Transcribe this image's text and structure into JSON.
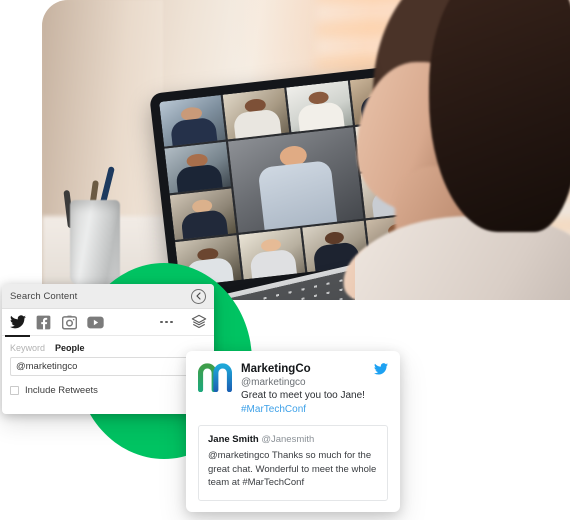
{
  "palette": {
    "brand_green": "#00c362",
    "twitter_blue": "#3ea1e8",
    "link_blue": "#3ea1e8",
    "panel_header_bg": "#ededed"
  },
  "hero": {
    "alt": "woman on video conference call with laptop showing grid of participants",
    "participant_count": 13
  },
  "search_panel": {
    "title": "Search Content",
    "back_icon": "chevron-left-icon",
    "networks": [
      {
        "name": "twitter-icon",
        "label": "Twitter",
        "active": true
      },
      {
        "name": "facebook-icon",
        "label": "Facebook",
        "active": false
      },
      {
        "name": "instagram-icon",
        "label": "Instagram",
        "active": false
      },
      {
        "name": "youtube-icon",
        "label": "YouTube",
        "active": false
      }
    ],
    "more_icon": "more-horizontal-icon",
    "layers_icon": "layers-icon",
    "tabs": [
      {
        "label": "Keyword",
        "active": false
      },
      {
        "label": "People",
        "active": true
      }
    ],
    "keyword_value": "@marketingco",
    "keyword_placeholder": "@marketingco",
    "search_icon": "search-icon",
    "retweets_label": "Include Retweets",
    "retweets_checked": false
  },
  "tweet": {
    "avatar_icon": "marketingco-logo",
    "display_name": "MarketingCo",
    "handle": "@marketingco",
    "text": "Great to meet you too Jane!",
    "hashtag": "#MarTechConf",
    "network_icon": "twitter-bird-icon",
    "quote": {
      "display_name": "Jane Smith",
      "handle": "@Janesmith",
      "text": "@marketingco Thanks so much for the great chat. Wonderful to meet the whole team at #MarTechConf"
    }
  }
}
